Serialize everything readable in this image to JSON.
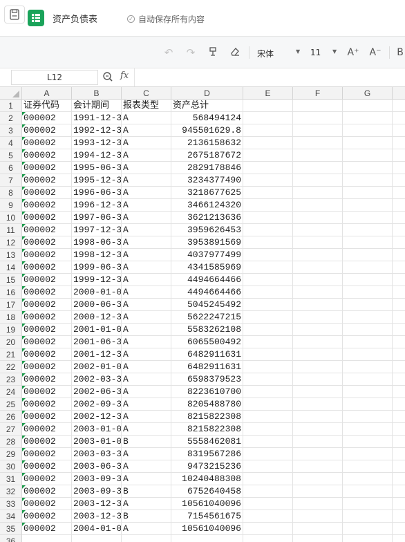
{
  "app": {
    "doc_title": "资产负债表",
    "autosave_text": "自动保存所有内容",
    "logo_color": "#1aa35a"
  },
  "toolbar": {
    "undo_icon": "undo-icon",
    "redo_icon": "redo-icon",
    "format_painter_icon": "format-painter-icon",
    "clear_format_icon": "eraser-icon",
    "font_name": "宋体",
    "font_size": "11",
    "increase_font_label": "A⁺",
    "decrease_font_label": "A⁻",
    "bold_label": "B"
  },
  "formula_bar": {
    "cell_ref": "L12",
    "fx_label": "fx",
    "formula": ""
  },
  "sheet": {
    "columns": [
      "A",
      "B",
      "C",
      "D",
      "E",
      "F",
      "G"
    ],
    "header_row": [
      "证券代码",
      "会计期间",
      "报表类型",
      "资产总计"
    ],
    "rows": [
      [
        "000002",
        "1991-12-3",
        "A",
        "568494124"
      ],
      [
        "000002",
        "1992-12-3",
        "A",
        "945501629.8"
      ],
      [
        "000002",
        "1993-12-3",
        "A",
        "2136158632"
      ],
      [
        "000002",
        "1994-12-3",
        "A",
        "2675187672"
      ],
      [
        "000002",
        "1995-06-3",
        "A",
        "2829178846"
      ],
      [
        "000002",
        "1995-12-3",
        "A",
        "3234377490"
      ],
      [
        "000002",
        "1996-06-3",
        "A",
        "3218677625"
      ],
      [
        "000002",
        "1996-12-3",
        "A",
        "3466124320"
      ],
      [
        "000002",
        "1997-06-3",
        "A",
        "3621213636"
      ],
      [
        "000002",
        "1997-12-3",
        "A",
        "3959626453"
      ],
      [
        "000002",
        "1998-06-3",
        "A",
        "3953891569"
      ],
      [
        "000002",
        "1998-12-3",
        "A",
        "4037977499"
      ],
      [
        "000002",
        "1999-06-3",
        "A",
        "4341585969"
      ],
      [
        "000002",
        "1999-12-3",
        "A",
        "4494664466"
      ],
      [
        "000002",
        "2000-01-0",
        "A",
        "4494664466"
      ],
      [
        "000002",
        "2000-06-3",
        "A",
        "5045245492"
      ],
      [
        "000002",
        "2000-12-3",
        "A",
        "5622247215"
      ],
      [
        "000002",
        "2001-01-0",
        "A",
        "5583262108"
      ],
      [
        "000002",
        "2001-06-3",
        "A",
        "6065500492"
      ],
      [
        "000002",
        "2001-12-3",
        "A",
        "6482911631"
      ],
      [
        "000002",
        "2002-01-0",
        "A",
        "6482911631"
      ],
      [
        "000002",
        "2002-03-3",
        "A",
        "6598379523"
      ],
      [
        "000002",
        "2002-06-3",
        "A",
        "8223610700"
      ],
      [
        "000002",
        "2002-09-3",
        "A",
        "8205488780"
      ],
      [
        "000002",
        "2002-12-3",
        "A",
        "8215822308"
      ],
      [
        "000002",
        "2003-01-0",
        "A",
        "8215822308"
      ],
      [
        "000002",
        "2003-01-0",
        "B",
        "5558462081"
      ],
      [
        "000002",
        "2003-03-3",
        "A",
        "8319567286"
      ],
      [
        "000002",
        "2003-06-3",
        "A",
        "9473215236"
      ],
      [
        "000002",
        "2003-09-3",
        "A",
        "10240488308"
      ],
      [
        "000002",
        "2003-09-3",
        "B",
        "6752640458"
      ],
      [
        "000002",
        "2003-12-3",
        "A",
        "10561040096"
      ],
      [
        "000002",
        "2003-12-3",
        "B",
        "7154561675"
      ],
      [
        "000002",
        "2004-01-0",
        "A",
        "10561040096"
      ]
    ]
  }
}
